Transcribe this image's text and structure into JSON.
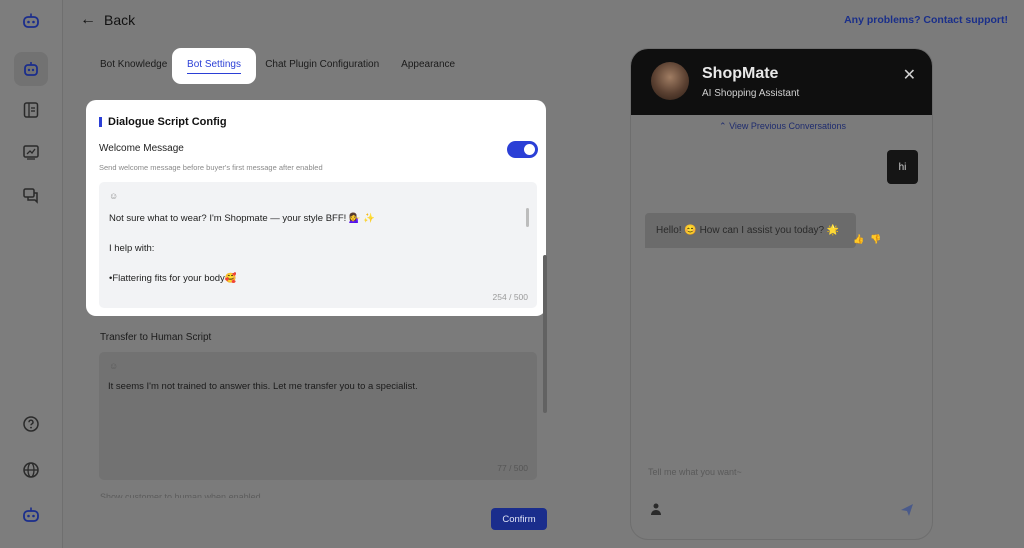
{
  "topbar": {
    "back_label": "Back",
    "help_link": "Any problems? Contact support!"
  },
  "rail": {
    "icons": [
      "bot-logo-icon",
      "bot-icon",
      "knowledge-icon",
      "analytics-icon",
      "chat-icon",
      "help-icon",
      "globe-icon",
      "bot-avatar-icon"
    ]
  },
  "tabs": [
    {
      "label": "Bot Knowledge"
    },
    {
      "label": "Bot Settings",
      "active": true
    },
    {
      "label": "Chat Plugin Configuration"
    },
    {
      "label": "Appearance"
    }
  ],
  "dialogue": {
    "title": "Dialogue Script Config",
    "welcome": {
      "label": "Welcome Message",
      "hint": "Send welcome message before buyer's first message after enabled",
      "enabled": true,
      "lines": [
        "Not sure what to wear? I'm Shopmate — your style BFF! 💁‍♀️ ✨",
        "",
        "I help with:",
        "",
        "•Flattering fits for your body🥰"
      ],
      "count": "254 / 500"
    },
    "transfer": {
      "label": "Transfer to Human Script",
      "text": "It seems I'm not trained to answer this. Let me transfer you to a specialist.",
      "count": "77 / 500"
    },
    "cut_text": "Show customer to human when enabled"
  },
  "confirm_label": "Confirm",
  "chat": {
    "name": "ShopMate",
    "subtitle": "AI Shopping Assistant",
    "close_icon": "close-icon",
    "view_previous": "View Previous Conversations",
    "user_message": "hi",
    "bot_message": "Hello! 😊 How can I assist you today? 🌟",
    "input_placeholder": "Tell me what you want~"
  },
  "colors": {
    "accent": "#2b3fd6",
    "confirm": "#1a2d8c",
    "chat_header": "#0f0f0f"
  }
}
